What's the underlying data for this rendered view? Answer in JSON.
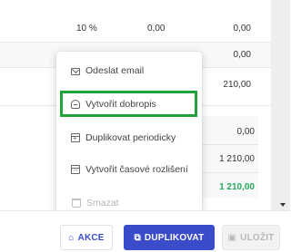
{
  "table": {
    "row1": {
      "percent": "10 %",
      "mid": "0,00",
      "right": "0,00"
    },
    "row2": {
      "right": "0,00"
    },
    "row3": {
      "right": "210,00"
    }
  },
  "summary": {
    "value1": "0,00",
    "value2": "1 210,00",
    "total": "1 210,00"
  },
  "menu": {
    "items": [
      {
        "label": "Odeslat email",
        "icon": "mail-icon",
        "disabled": false
      },
      {
        "label": "Vytvořit dobropis",
        "icon": "refund-icon",
        "disabled": false,
        "highlighted": true
      },
      {
        "label": "Duplikovat periodicky",
        "icon": "calendar-plus-icon",
        "disabled": false
      },
      {
        "label": "Vytvořit časové rozlišení",
        "icon": "calendar-range-icon",
        "disabled": false
      },
      {
        "label": "Smazat",
        "icon": "trash-icon",
        "disabled": true
      }
    ]
  },
  "footer": {
    "actions_label": "AKCE",
    "duplicate_label": "DUPLIKOVAT",
    "save_label": "ULOŽIT"
  },
  "colors": {
    "primary": "#3b4ccb",
    "highlight_border": "#22a33a",
    "total_green": "#27a85a"
  }
}
